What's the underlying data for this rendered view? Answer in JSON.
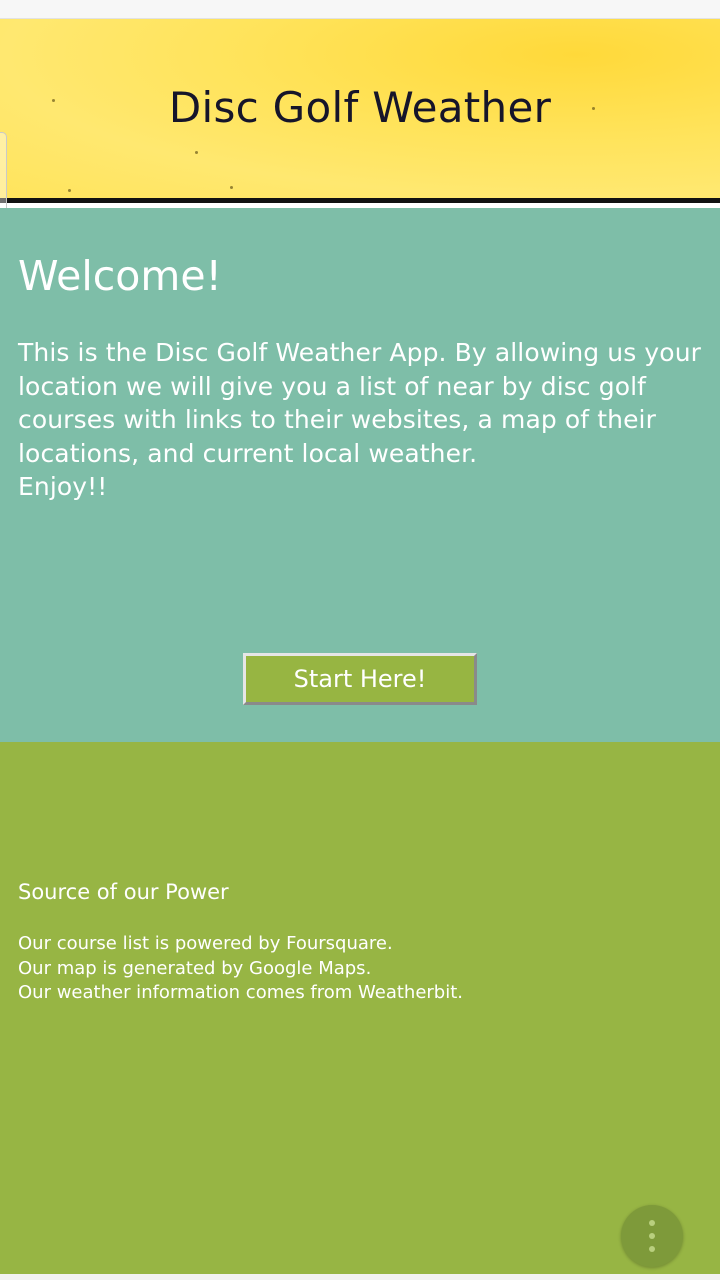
{
  "header": {
    "title": "Disc Golf Weather"
  },
  "welcome": {
    "title": "Welcome!",
    "body": "This is the Disc Golf Weather App. By allowing us your location we will give you a list of near by disc golf courses with links to their websites, a map of their locations, and current local weather.\nEnjoy!!",
    "button_label": "Start Here!"
  },
  "footer": {
    "title": "Source of our Power",
    "lines": [
      "Our course list is powered by Foursquare.",
      "Our map is generated by Google Maps.",
      "Our weather information comes from Weatherbit."
    ]
  },
  "fab": {
    "icon": "more-vert-icon"
  },
  "colors": {
    "header_bg": "#ffe35a",
    "welcome_bg": "#7ebea8",
    "footer_bg": "#97b544",
    "button_bg": "#97b542",
    "title_text": "#16152a"
  }
}
